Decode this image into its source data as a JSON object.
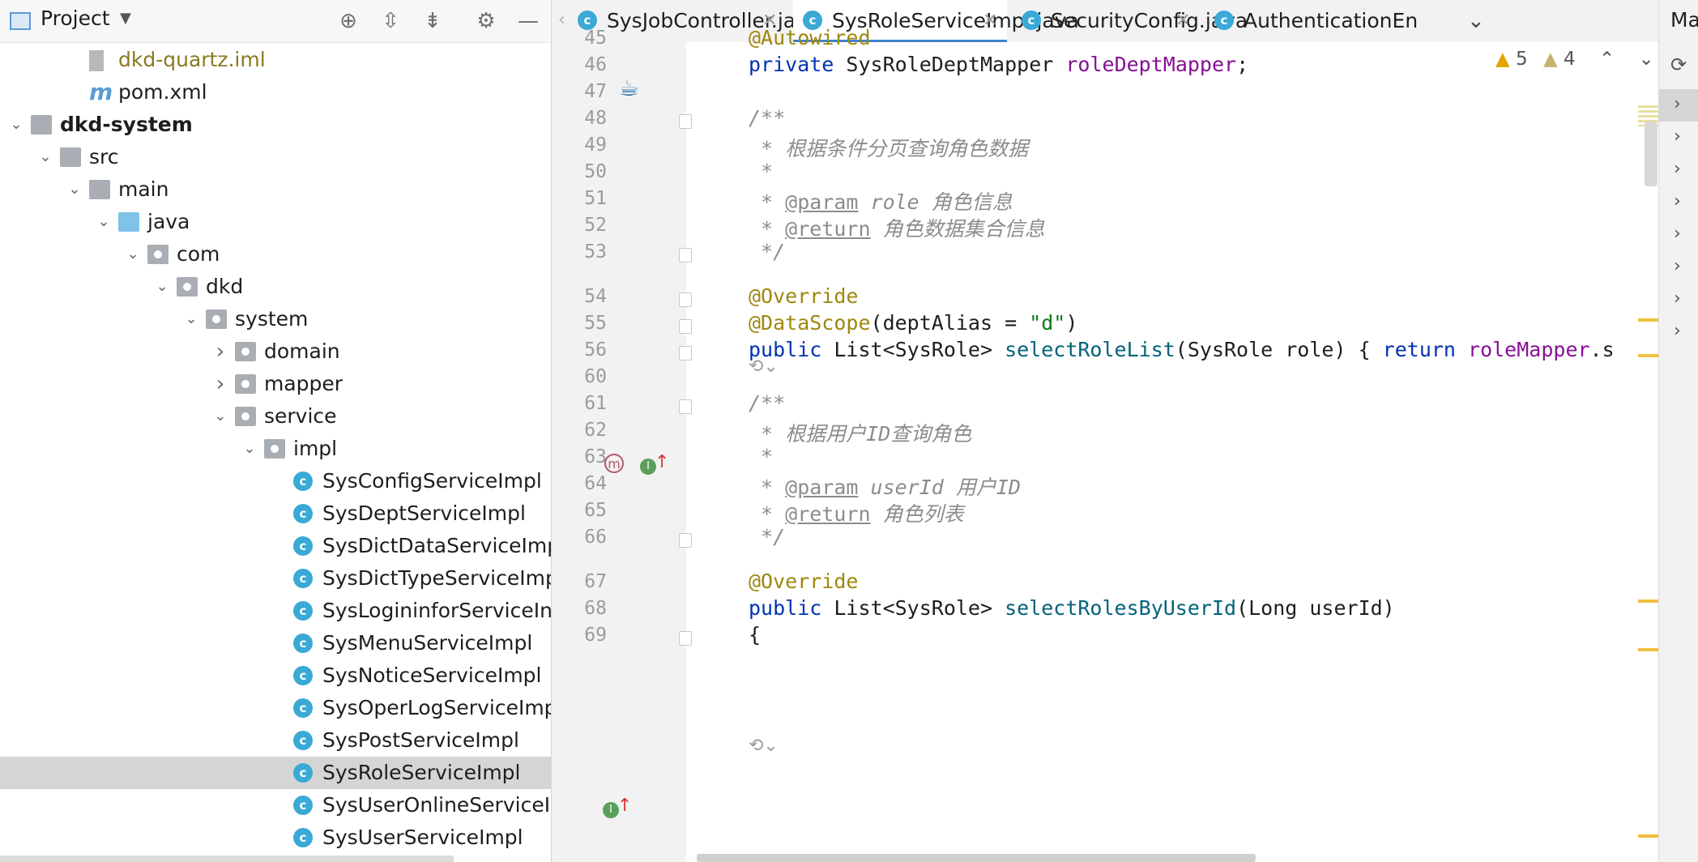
{
  "project_panel": {
    "title": "Project",
    "tree": [
      {
        "label": "dkd-quartz.iml",
        "kind": "file-iml",
        "indent": 3
      },
      {
        "label": "pom.xml",
        "kind": "file-maven",
        "indent": 3
      },
      {
        "label": "dkd-system",
        "kind": "module",
        "indent": 1,
        "expanded": true,
        "bold": true
      },
      {
        "label": "src",
        "kind": "folder",
        "indent": 2,
        "expanded": true
      },
      {
        "label": "main",
        "kind": "folder",
        "indent": 3,
        "expanded": true
      },
      {
        "label": "java",
        "kind": "folder-source",
        "indent": 4,
        "expanded": true
      },
      {
        "label": "com",
        "kind": "package",
        "indent": 5,
        "expanded": true
      },
      {
        "label": "dkd",
        "kind": "package",
        "indent": 6,
        "expanded": true
      },
      {
        "label": "system",
        "kind": "package",
        "indent": 7,
        "expanded": true
      },
      {
        "label": "domain",
        "kind": "package",
        "indent": 8,
        "expanded": false
      },
      {
        "label": "mapper",
        "kind": "package",
        "indent": 8,
        "expanded": false
      },
      {
        "label": "service",
        "kind": "package",
        "indent": 8,
        "expanded": true
      },
      {
        "label": "impl",
        "kind": "package",
        "indent": 9,
        "expanded": true
      },
      {
        "label": "SysConfigServiceImpl",
        "kind": "class",
        "indent": 10
      },
      {
        "label": "SysDeptServiceImpl",
        "kind": "class",
        "indent": 10
      },
      {
        "label": "SysDictDataServiceImp",
        "kind": "class",
        "indent": 10
      },
      {
        "label": "SysDictTypeServiceImp",
        "kind": "class",
        "indent": 10
      },
      {
        "label": "SysLogininforServiceIn",
        "kind": "class",
        "indent": 10
      },
      {
        "label": "SysMenuServiceImpl",
        "kind": "class",
        "indent": 10
      },
      {
        "label": "SysNoticeServiceImpl",
        "kind": "class",
        "indent": 10
      },
      {
        "label": "SysOperLogServiceImp",
        "kind": "class",
        "indent": 10
      },
      {
        "label": "SysPostServiceImpl",
        "kind": "class",
        "indent": 10
      },
      {
        "label": "SysRoleServiceImpl",
        "kind": "class",
        "indent": 10,
        "selected": true
      },
      {
        "label": "SysUserOnlineServiceI",
        "kind": "class",
        "indent": 10
      },
      {
        "label": "SysUserServiceImpl",
        "kind": "class",
        "indent": 10
      }
    ]
  },
  "tabs": [
    {
      "label": "SysJobController.java",
      "active": false
    },
    {
      "label": "SysRoleServiceImpl.java",
      "active": true
    },
    {
      "label": "SecurityConfig.java",
      "active": false
    },
    {
      "label": "AuthenticationEn",
      "active": false
    }
  ],
  "right_tab_cut": "Ma",
  "inspections": {
    "warnings": "5",
    "weak_warnings": "4"
  },
  "code_lines": [
    {
      "n": "45",
      "tokens": [
        [
          "ann",
          "@Autowired"
        ]
      ]
    },
    {
      "n": "46",
      "tokens": [
        [
          "kw",
          "private "
        ],
        [
          "plain",
          "SysRoleDeptMapper "
        ],
        [
          "fld",
          "roleDeptMapper"
        ],
        [
          "plain",
          ";"
        ]
      ]
    },
    {
      "n": "47",
      "tokens": []
    },
    {
      "n": "48",
      "tokens": [
        [
          "cmt",
          "/**"
        ]
      ]
    },
    {
      "n": "49",
      "tokens": [
        [
          "cmt",
          " * 根据条件分页查询角色数据"
        ]
      ]
    },
    {
      "n": "50",
      "tokens": [
        [
          "cmt",
          " *"
        ]
      ]
    },
    {
      "n": "51",
      "tokens": [
        [
          "cmt",
          " * "
        ],
        [
          "tag",
          "@param"
        ],
        [
          "cmt",
          " role 角色信息"
        ]
      ]
    },
    {
      "n": "52",
      "tokens": [
        [
          "cmt",
          " * "
        ],
        [
          "tag",
          "@return"
        ],
        [
          "cmt",
          " 角色数据集合信息"
        ]
      ]
    },
    {
      "n": "53",
      "tokens": [
        [
          "cmt",
          " */"
        ]
      ]
    },
    {
      "n": "54",
      "tokens": [
        [
          "ann",
          "@Override"
        ]
      ]
    },
    {
      "n": "55",
      "tokens": [
        [
          "ann",
          "@DataScope"
        ],
        [
          "plain",
          "(deptAlias = "
        ],
        [
          "str",
          "\"d\""
        ],
        [
          "plain",
          ")"
        ]
      ]
    },
    {
      "n": "56",
      "tokens": [
        [
          "kw",
          "public "
        ],
        [
          "plain",
          "List<SysRole> "
        ],
        [
          "mth",
          "selectRoleList"
        ],
        [
          "plain",
          "(SysRole role) { "
        ],
        [
          "kw",
          "return "
        ],
        [
          "fld",
          "roleMapper"
        ],
        [
          "plain",
          ".s"
        ]
      ]
    },
    {
      "n": "60",
      "tokens": []
    },
    {
      "n": "61",
      "tokens": [
        [
          "cmt",
          "/**"
        ]
      ]
    },
    {
      "n": "62",
      "tokens": [
        [
          "cmt",
          " * 根据用户ID查询角色"
        ]
      ]
    },
    {
      "n": "63",
      "tokens": [
        [
          "cmt",
          " *"
        ]
      ]
    },
    {
      "n": "64",
      "tokens": [
        [
          "cmt",
          " * "
        ],
        [
          "tag",
          "@param"
        ],
        [
          "cmt",
          " userId 用户ID"
        ]
      ]
    },
    {
      "n": "65",
      "tokens": [
        [
          "cmt",
          " * "
        ],
        [
          "tag",
          "@return"
        ],
        [
          "cmt",
          " 角色列表"
        ]
      ]
    },
    {
      "n": "66",
      "tokens": [
        [
          "cmt",
          " */"
        ]
      ]
    },
    {
      "n": "67",
      "tokens": [
        [
          "ann",
          "@Override"
        ]
      ]
    },
    {
      "n": "68",
      "tokens": [
        [
          "kw",
          "public "
        ],
        [
          "plain",
          "List<SysRole> "
        ],
        [
          "mth",
          "selectRolesByUserId"
        ],
        [
          "plain",
          "(Long userId)"
        ]
      ]
    },
    {
      "n": "69",
      "tokens": [
        [
          "plain",
          "{"
        ]
      ]
    }
  ],
  "colors": {
    "keyword": "#0033b3",
    "annotation": "#9e880d",
    "field": "#871094",
    "method": "#00627a",
    "string": "#067d17",
    "comment": "#8c8c8c",
    "accent": "#4083c9"
  }
}
